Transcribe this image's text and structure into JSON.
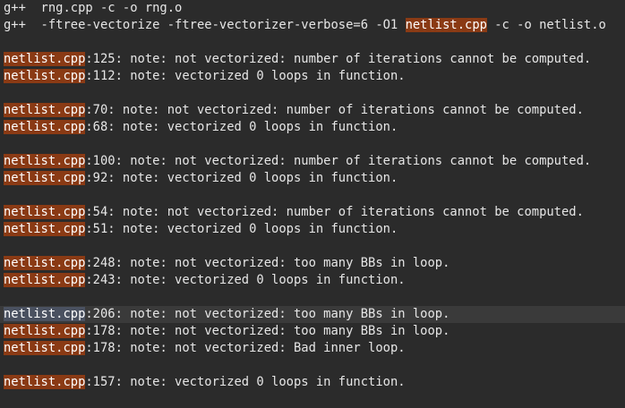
{
  "colors": {
    "background": "#2b2b2b",
    "foreground": "#e6e6e6",
    "match_highlight": "#8a3a14",
    "current_match_highlight": "#4a5160",
    "current_line": "#3a3a3a"
  },
  "search": {
    "term": "netlist.cpp"
  },
  "lines": [
    {
      "segments": [
        {
          "text": "g++  rng.cpp -c -o rng.o",
          "hl": false
        }
      ]
    },
    {
      "segments": [
        {
          "text": "g++  -ftree-vectorize -ftree-vectorizer-verbose=6 -O1 ",
          "hl": false
        },
        {
          "text": "netlist.cpp",
          "hl": true
        },
        {
          "text": " -c -o netlist.o",
          "hl": false
        }
      ]
    },
    {
      "segments": []
    },
    {
      "segments": [
        {
          "text": "netlist.cpp",
          "hl": true
        },
        {
          "text": ":125: note: not vectorized: number of iterations cannot be computed.",
          "hl": false
        }
      ]
    },
    {
      "segments": [
        {
          "text": "netlist.cpp",
          "hl": true
        },
        {
          "text": ":112: note: vectorized 0 loops in function.",
          "hl": false
        }
      ]
    },
    {
      "segments": []
    },
    {
      "segments": [
        {
          "text": "netlist.cpp",
          "hl": true
        },
        {
          "text": ":70: note: not vectorized: number of iterations cannot be computed.",
          "hl": false
        }
      ]
    },
    {
      "segments": [
        {
          "text": "netlist.cpp",
          "hl": true
        },
        {
          "text": ":68: note: vectorized 0 loops in function.",
          "hl": false
        }
      ]
    },
    {
      "segments": []
    },
    {
      "segments": [
        {
          "text": "netlist.cpp",
          "hl": true
        },
        {
          "text": ":100: note: not vectorized: number of iterations cannot be computed.",
          "hl": false
        }
      ]
    },
    {
      "segments": [
        {
          "text": "netlist.cpp",
          "hl": true
        },
        {
          "text": ":92: note: vectorized 0 loops in function.",
          "hl": false
        }
      ]
    },
    {
      "segments": []
    },
    {
      "segments": [
        {
          "text": "netlist.cpp",
          "hl": true
        },
        {
          "text": ":54: note: not vectorized: number of iterations cannot be computed.",
          "hl": false
        }
      ]
    },
    {
      "segments": [
        {
          "text": "netlist.cpp",
          "hl": true
        },
        {
          "text": ":51: note: vectorized 0 loops in function.",
          "hl": false
        }
      ]
    },
    {
      "segments": []
    },
    {
      "segments": [
        {
          "text": "netlist.cpp",
          "hl": true
        },
        {
          "text": ":248: note: not vectorized: too many BBs in loop.",
          "hl": false
        }
      ]
    },
    {
      "segments": [
        {
          "text": "netlist.cpp",
          "hl": true
        },
        {
          "text": ":243: note: vectorized 0 loops in function.",
          "hl": false
        }
      ]
    },
    {
      "segments": []
    },
    {
      "current": true,
      "segments": [
        {
          "text": "netlist.cpp",
          "hl": true
        },
        {
          "text": ":206: note: not vectorized: too many BBs in loop.",
          "hl": false
        }
      ]
    },
    {
      "segments": [
        {
          "text": "netlist.cpp",
          "hl": true
        },
        {
          "text": ":178: note: not vectorized: too many BBs in loop.",
          "hl": false
        }
      ]
    },
    {
      "segments": [
        {
          "text": "netlist.cpp",
          "hl": true
        },
        {
          "text": ":178: note: not vectorized: Bad inner loop.",
          "hl": false
        }
      ]
    },
    {
      "segments": []
    },
    {
      "segments": [
        {
          "text": "netlist.cpp",
          "hl": true
        },
        {
          "text": ":157: note: vectorized 0 loops in function.",
          "hl": false
        }
      ]
    },
    {
      "segments": []
    }
  ]
}
